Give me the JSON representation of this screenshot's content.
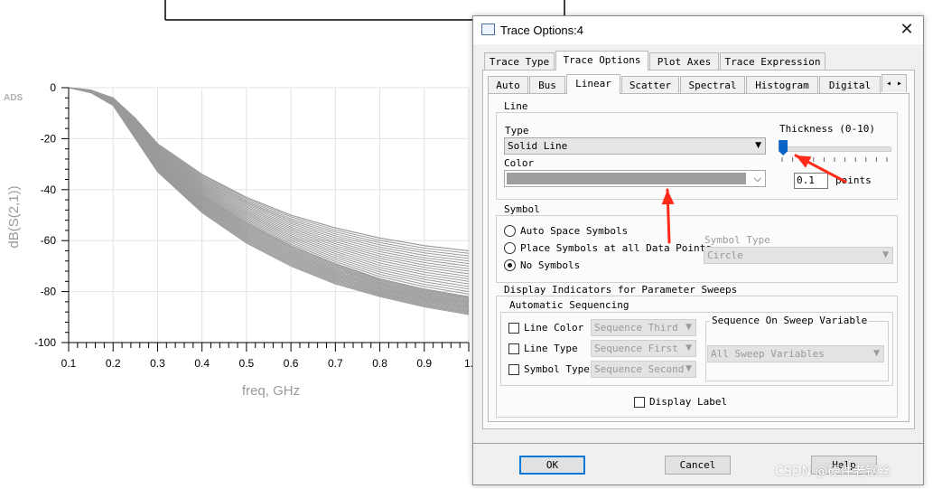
{
  "plot": {
    "watermark": "ADS",
    "y_axis_label": "dB(S(2,1))",
    "x_axis_label": "freq, GHz",
    "y_ticks": [
      "0",
      "-20",
      "-40",
      "-60",
      "-80",
      "-100"
    ],
    "x_ticks": [
      "0.1",
      "0.2",
      "0.3",
      "0.4",
      "0.5",
      "0.6",
      "0.7",
      "0.8",
      "0.9",
      "1."
    ],
    "trace_color": "#9a9a9a"
  },
  "chart_data": {
    "type": "line",
    "xlabel": "freq, GHz",
    "ylabel": "dB(S(2,1))",
    "xlim": [
      0.1,
      1.0
    ],
    "ylim": [
      -100,
      0
    ],
    "series_count_note": "",
    "grid": true,
    "series": [
      {
        "x": [
          0.1,
          0.15,
          0.2,
          0.25,
          0.3,
          0.4,
          0.5,
          0.6,
          0.7,
          0.8,
          0.9,
          1.0
        ],
        "values": [
          0,
          -1,
          -4,
          -12,
          -22,
          -34,
          -43,
          -50,
          -55,
          -59,
          -62,
          -64
        ]
      },
      {
        "x": [
          0.1,
          0.15,
          0.2,
          0.25,
          0.3,
          0.4,
          0.5,
          0.6,
          0.7,
          0.8,
          0.9,
          1.0
        ],
        "values": [
          0,
          -1,
          -5,
          -16,
          -28,
          -42,
          -53,
          -62,
          -69,
          -75,
          -79,
          -82
        ]
      },
      {
        "x": [
          0.1,
          0.15,
          0.2,
          0.25,
          0.3,
          0.4,
          0.5,
          0.6,
          0.7,
          0.8,
          0.9,
          1.0
        ],
        "values": [
          0,
          -2,
          -7,
          -20,
          -33,
          -49,
          -61,
          -70,
          -77,
          -82,
          -86,
          -89
        ]
      }
    ]
  },
  "dialog": {
    "title": "Trace Options:4",
    "close_glyph": "✕",
    "top_tabs": [
      "Trace Type",
      "Trace Options",
      "Plot Axes",
      "Trace Expression"
    ],
    "top_tab_active": 1,
    "sub_tabs": [
      "Auto",
      "Bus",
      "Linear",
      "Scatter",
      "Spectral",
      "Histogram",
      "Digital",
      "◂ ▸"
    ],
    "sub_tab_active": 2,
    "line_group": {
      "title": "Line",
      "type_label": "Type",
      "type_value": "Solid Line",
      "color_label": "Color",
      "color_value": "#9e9e9e",
      "thickness_label": "Thickness (0-10)",
      "thickness_value": "0.1",
      "thickness_unit": "points",
      "thickness_fraction": 0.01
    },
    "symbol_group": {
      "title": "Symbol",
      "options": [
        "Auto Space Symbols",
        "Place Symbols at all Data Points",
        "No Symbols"
      ],
      "selected": 2,
      "symbol_type_label": "Symbol Type",
      "symbol_type_value": "Circle"
    },
    "indicators_group": {
      "title": "Display Indicators for Parameter Sweeps",
      "auto_seq_title": "Automatic Sequencing",
      "rows": [
        {
          "label": "Line Color",
          "value": "Sequence Third"
        },
        {
          "label": "Line Type",
          "value": "Sequence First"
        },
        {
          "label": "Symbol Type",
          "value": "Sequence Second"
        }
      ],
      "sweep_var_title": "Sequence On Sweep Variable",
      "sweep_var_value": "All Sweep Variables"
    },
    "display_label": "Display Label",
    "buttons": {
      "ok": "OK",
      "cancel": "Cancel",
      "help": "Help"
    }
  },
  "watermark": "CSDN @硬件老钢丝",
  "colors": {
    "annotation_arrow": "#ff2a1a",
    "accent": "#0078d7"
  }
}
